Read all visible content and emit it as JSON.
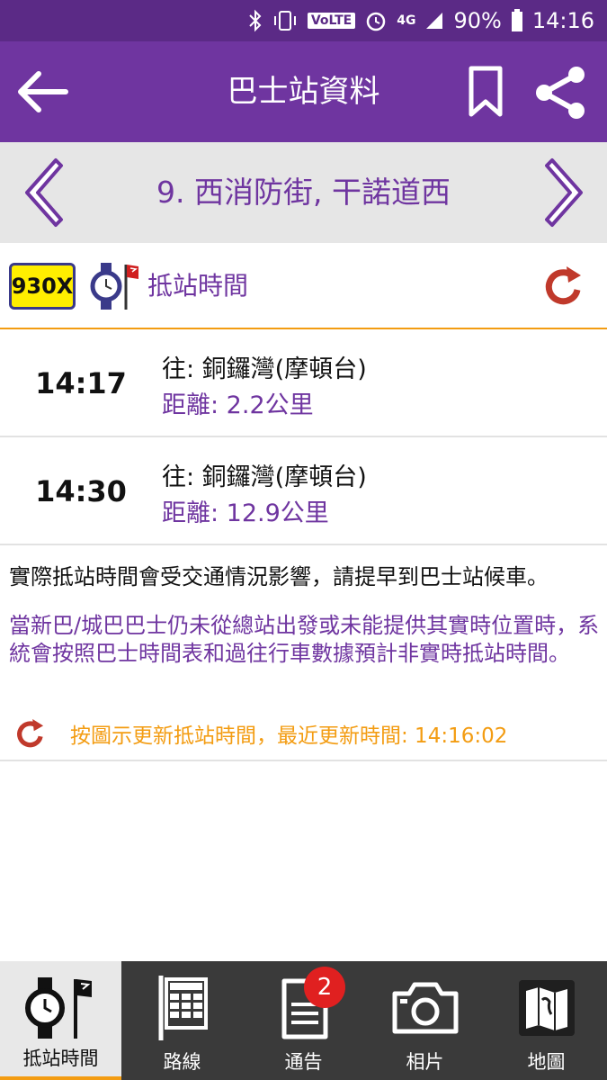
{
  "status_bar": {
    "volte": "VoLTE",
    "network": "4G",
    "battery": "90%",
    "time": "14:16",
    "icons": [
      "bluetooth-icon",
      "vibrate-icon",
      "alarm-icon",
      "signal-icon",
      "battery-icon"
    ]
  },
  "app_bar": {
    "title": "巴士站資料",
    "icons": [
      "back-arrow-icon",
      "bookmark-icon",
      "share-icon"
    ]
  },
  "stop": {
    "name": "9. 西消防街, 干諾道西"
  },
  "subheader": {
    "route": "930X",
    "label": "抵站時間"
  },
  "etas": [
    {
      "time": "14:17",
      "destination": "往: 銅鑼灣(摩頓台)",
      "distance": "距離: 2.2公里"
    },
    {
      "time": "14:30",
      "destination": "往: 銅鑼灣(摩頓台)",
      "distance": "距離: 12.9公里"
    }
  ],
  "notices": {
    "traffic": "實際抵站時間會受交通情況影響，請提早到巴士站候車。",
    "schedule": "當新巴/城巴巴士仍未從總站出發或未能提供其實時位置時，系統會按照巴士時間表和過往行車數據預計非實時抵站時間。",
    "update": "按圖示更新抵站時間，最近更新時間: 14:16:02"
  },
  "bottom_nav": {
    "items": [
      {
        "label": "抵站時間",
        "icon": "eta-watch-flag-icon",
        "active": true
      },
      {
        "label": "路線",
        "icon": "route-table-icon",
        "active": false
      },
      {
        "label": "通告",
        "icon": "notice-document-icon",
        "active": false
      },
      {
        "label": "相片",
        "icon": "camera-icon",
        "active": false
      },
      {
        "label": "地圖",
        "icon": "map-icon",
        "active": false
      }
    ],
    "notice_badge": "2"
  },
  "colors": {
    "primary": "#6f35a0",
    "status_bar": "#5b2a86",
    "accent": "#f39c12",
    "refresh": "#c0392b",
    "route_badge": "#ffee00"
  }
}
